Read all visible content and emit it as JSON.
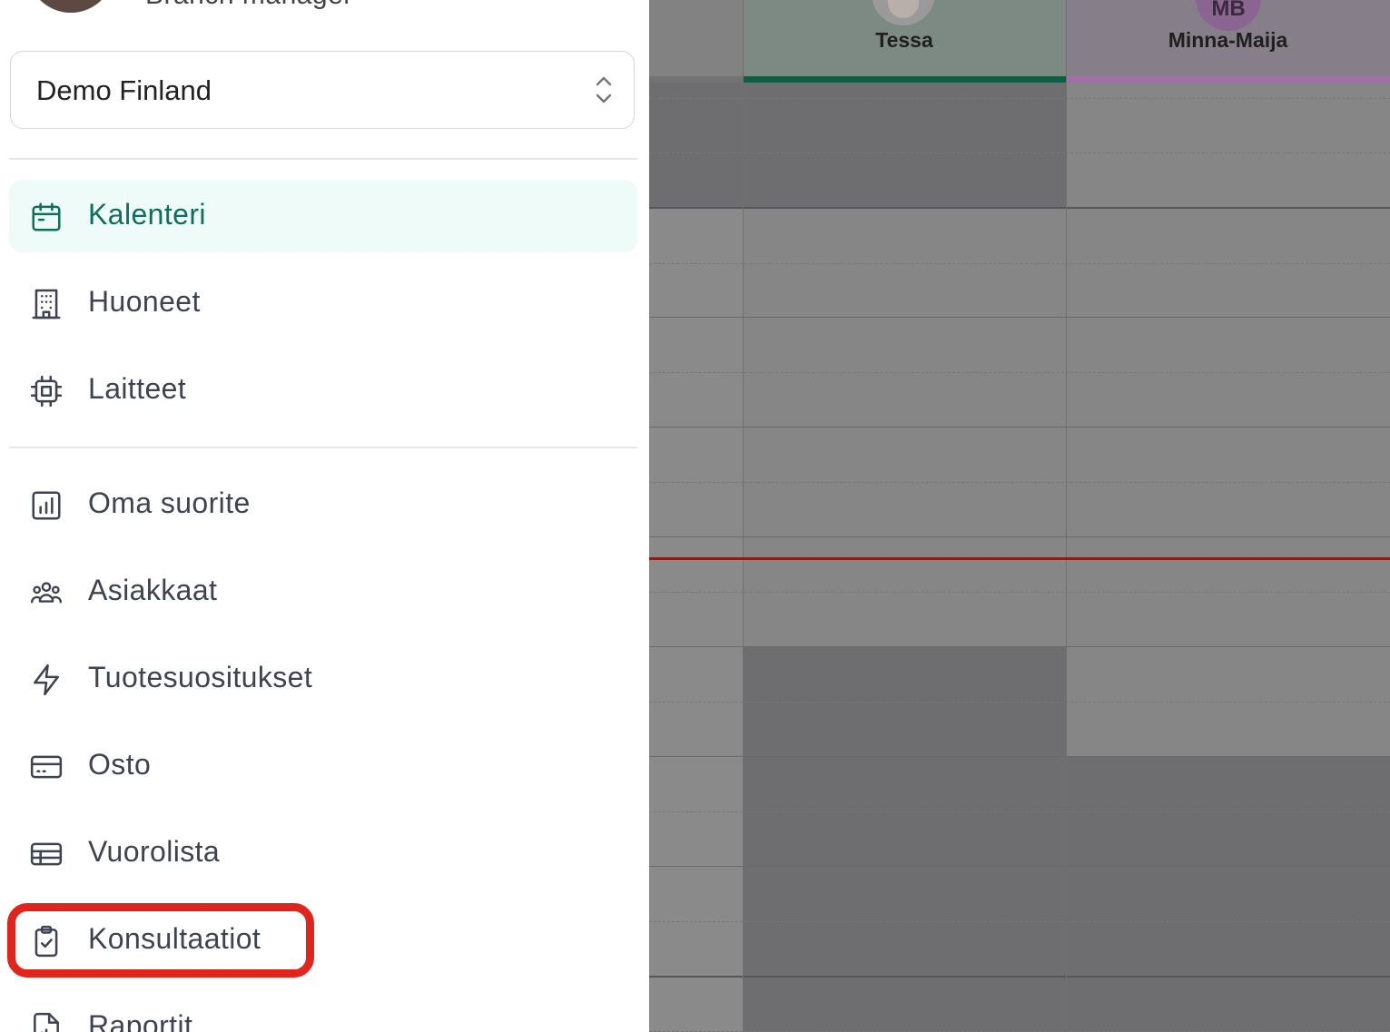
{
  "user": {
    "role": "Branch manager"
  },
  "branch_select": {
    "value": "Demo Finland"
  },
  "nav": {
    "kalenteri": "Kalenteri",
    "huoneet": "Huoneet",
    "laitteet": "Laitteet",
    "oma_suorite": "Oma suorite",
    "asiakkaat": "Asiakkaat",
    "tuotesuositukset": "Tuotesuositukset",
    "osto": "Osto",
    "vuorolista": "Vuorolista",
    "konsultaatiot": "Konsultaatiot",
    "raportit": "Raportit"
  },
  "calendar": {
    "staff": [
      {
        "name": "Tessa",
        "accent": "#0f6f4e"
      },
      {
        "name": "Minna-Maija",
        "initials": "MB",
        "accent": "#b07ab9"
      }
    ]
  },
  "colors": {
    "accent": "#0f6f5e",
    "highlight": "#e0261c",
    "now_line": "#8d1b1b"
  }
}
